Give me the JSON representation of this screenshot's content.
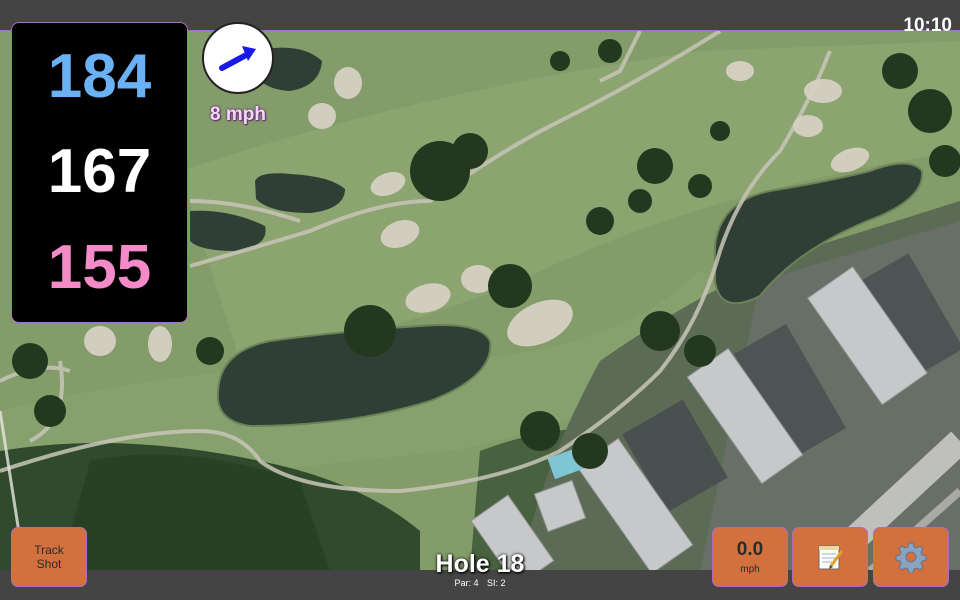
{
  "status": {
    "time": "10:10"
  },
  "yardages": {
    "back": "184",
    "center": "167",
    "front": "155"
  },
  "wind": {
    "speed_label": "8 mph",
    "arrow_color": "#1a1ae6",
    "direction_icon": "arrow-northeast-icon"
  },
  "buttons": {
    "track_shot_line1": "Track",
    "track_shot_line2": "Shot",
    "speed_value": "0.0",
    "speed_unit": "mph",
    "notes_icon": "notepad-icon",
    "settings_icon": "gear-icon"
  },
  "hole": {
    "title": "Hole 18",
    "par": "Par: 4",
    "si": "SI: 2"
  },
  "colors": {
    "accent_border": "#b06cc2",
    "button_bg": "#d2703e",
    "back_yardage": "#6ab2f5",
    "front_yardage": "#f48ac7"
  }
}
